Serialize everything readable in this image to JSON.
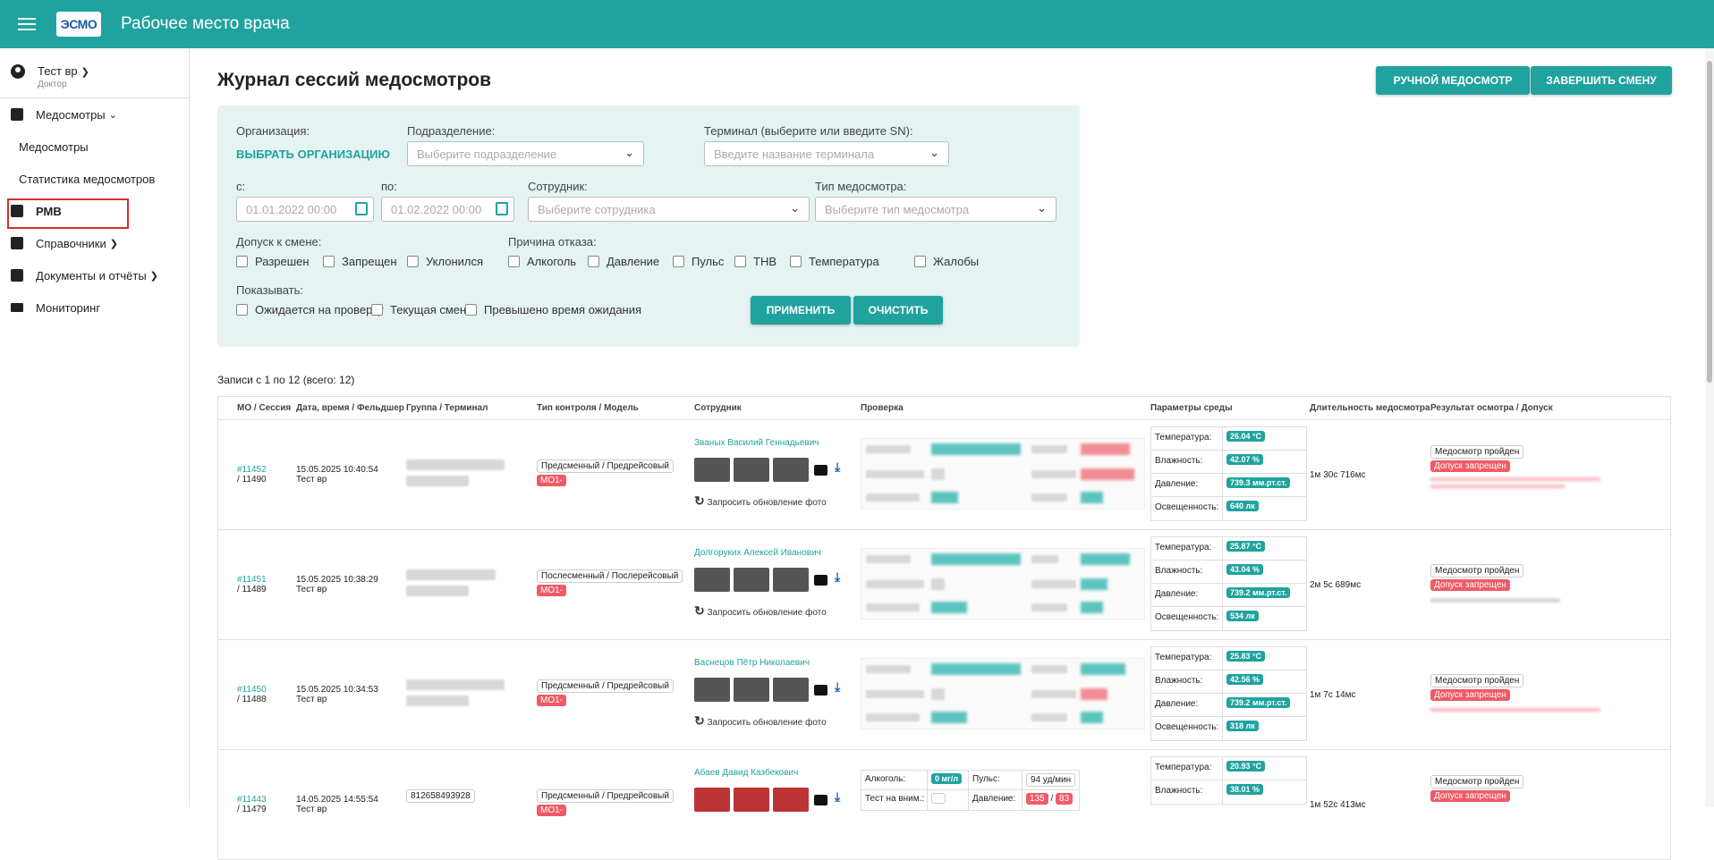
{
  "header": {
    "logo_text": "ЭСМО",
    "title": "Рабочее место врача"
  },
  "sidebar": {
    "user_name": "Тест вр",
    "user_role": "Доктор",
    "items": [
      {
        "label": "Медосмотры"
      },
      {
        "label": "Медосмотры"
      },
      {
        "label": "Статистика медосмотров"
      },
      {
        "label": "РМВ"
      },
      {
        "label": "Справочники"
      },
      {
        "label": "Документы и отчёты"
      },
      {
        "label": "Мониторинг"
      }
    ]
  },
  "page": {
    "title": "Журнал сессий медосмотров",
    "btn_manual": "РУЧНОЙ МЕДОСМОТР",
    "btn_finish": "ЗАВЕРШИТЬ СМЕНУ"
  },
  "filters": {
    "org_label": "Организация:",
    "org_link": "ВЫБРАТЬ ОРГАНИЗАЦИЮ",
    "dept_label": "Подразделение:",
    "dept_placeholder": "Выберите подразделение",
    "terminal_label": "Терминал (выберите или введите SN):",
    "terminal_placeholder": "Введите название терминала",
    "from_label": "с:",
    "from_value": "01.01.2022 00:00",
    "to_label": "по:",
    "to_value": "01.02.2022 00:00",
    "employee_label": "Сотрудник:",
    "employee_placeholder": "Выберите сотрудника",
    "type_label": "Тип медосмотра:",
    "type_placeholder": "Выберите тип медосмотра",
    "admission_label": "Допуск к смене:",
    "admission_options": [
      "Разрешен",
      "Запрещен",
      "Уклонился"
    ],
    "reason_label": "Причина отказа:",
    "reason_options": [
      "Алкоголь",
      "Давление",
      "Пульс",
      "ТНВ",
      "Температура",
      "Жалобы"
    ],
    "show_label": "Показывать:",
    "show_options": [
      "Ожидается на проверку",
      "Текущая смена",
      "Превышено время ожидания"
    ],
    "btn_apply": "ПРИМЕНИТЬ",
    "btn_clear": "ОЧИСТИТЬ"
  },
  "records_text": "Записи с 1 по 12 (всего: 12)",
  "table": {
    "columns": [
      "МО / Сессия",
      "Дата, время / Фельдшер",
      "Группа / Терминал",
      "Тип контроля / Модель",
      "Сотрудник",
      "Проверка",
      "Параметры среды",
      "Длительность медосмотра",
      "Результат осмотра / Допуск"
    ],
    "env_labels": [
      "Температура:",
      "Влажность:",
      "Давление:",
      "Освещенность:"
    ],
    "refresh_label": "Запросить обновление фото",
    "rows": [
      {
        "mo": "#11452",
        "session": "/ 11490",
        "date": "15.05.2025 10:40:54",
        "medic": "Тест вр",
        "type": "Предсменный / Предрейсовый",
        "model": "МО1-",
        "employee": "Званых Василий Геннадьевич",
        "env": [
          "26.04 °C",
          "42.07 %",
          "739.3 мм.рт.ст.",
          "640 лк"
        ],
        "duration": "1м 30с 716мс",
        "result": "Медосмотр пройден",
        "admission": "Допуск запрещен"
      },
      {
        "mo": "#11451",
        "session": "/ 11489",
        "date": "15.05.2025 10:38:29",
        "medic": "Тест вр",
        "type": "Послесменный / Послерейсовый",
        "model": "МО1-",
        "employee": "Долгоруких Алексей Иванович",
        "env": [
          "25.87 °C",
          "43.04 %",
          "739.2 мм.рт.ст.",
          "534 лк"
        ],
        "duration": "2м 5с 689мс",
        "result": "Медосмотр пройден",
        "admission": "Допуск запрещен"
      },
      {
        "mo": "#11450",
        "session": "/ 11488",
        "date": "15.05.2025 10:34:53",
        "medic": "Тест вр",
        "type": "Предсменный / Предрейсовый",
        "model": "МО1-",
        "employee": "Васнецов Пётр Николаевич",
        "env": [
          "25.83 °C",
          "42.56 %",
          "739.2 мм.рт.ст.",
          "318 лк"
        ],
        "duration": "1м 7с 14мс",
        "result": "Медосмотр пройден",
        "admission": "Допуск запрещен"
      },
      {
        "mo": "#11443",
        "session": "/ 11479",
        "date": "14.05.2025 14:55:54",
        "medic": "Тест вр",
        "terminal": "812658493928",
        "type": "Предсменный / Предрейсовый",
        "model": "МО1-",
        "employee": "Абаев Давид Казбекович",
        "env": [
          "20.93 °C",
          "38.01 %",
          "",
          ""
        ],
        "duration": "1м 52с 413мс",
        "result": "Медосмотр пройден",
        "admission": "Допуск запрещен",
        "checks": {
          "alcohol_label": "Алкоголь:",
          "alcohol_value": "0 мг/л",
          "pulse_label": "Пульс:",
          "pulse_value": "94 уд/мин",
          "attention_label": "Тест на вним.:",
          "pressure_label": "Давление:",
          "pressure_sys": "135",
          "pressure_sep": "/",
          "pressure_dia": "83"
        }
      }
    ]
  }
}
